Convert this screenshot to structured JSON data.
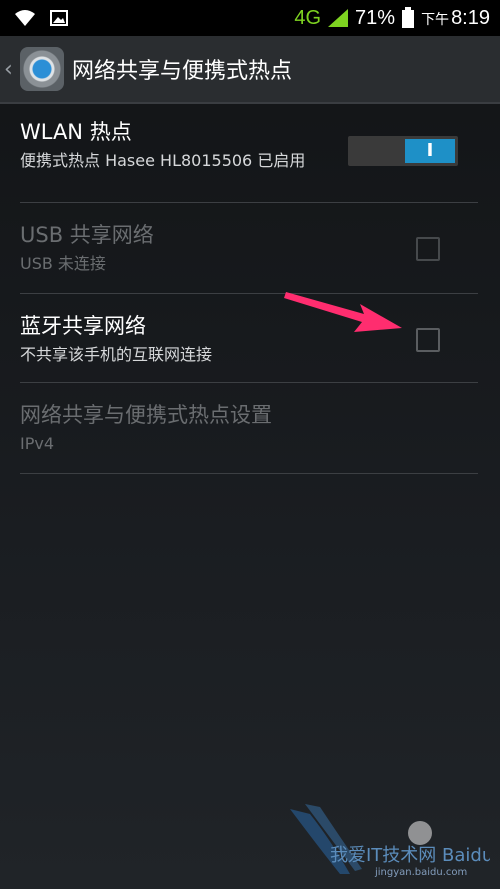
{
  "status_bar": {
    "network": "4G",
    "battery_percent": "71%",
    "time_prefix": "下午",
    "time": "8:19"
  },
  "header": {
    "title": "网络共享与便携式热点"
  },
  "items": [
    {
      "title": "WLAN 热点",
      "subtitle": "便携式热点 Hasee HL8015506 已启用",
      "control": "toggle",
      "toggle_on": true,
      "toggle_label": "I"
    },
    {
      "title": "USB 共享网络",
      "subtitle": "USB 未连接",
      "control": "checkbox",
      "checked": false,
      "enabled": false
    },
    {
      "title": "蓝牙共享网络",
      "subtitle": "不共享该手机的互联网连接",
      "control": "checkbox",
      "checked": false,
      "enabled": true
    },
    {
      "title": "网络共享与便携式热点设置",
      "subtitle": "IPv4",
      "control": "none",
      "enabled": false
    }
  ],
  "watermark": {
    "text": "我爱IT技术网 Baidu经验",
    "url": "jingyan.baidu.com"
  },
  "colors": {
    "accent": "#1e90c7",
    "annotation_arrow": "#ff2d6f",
    "signal": "#7ed321"
  }
}
